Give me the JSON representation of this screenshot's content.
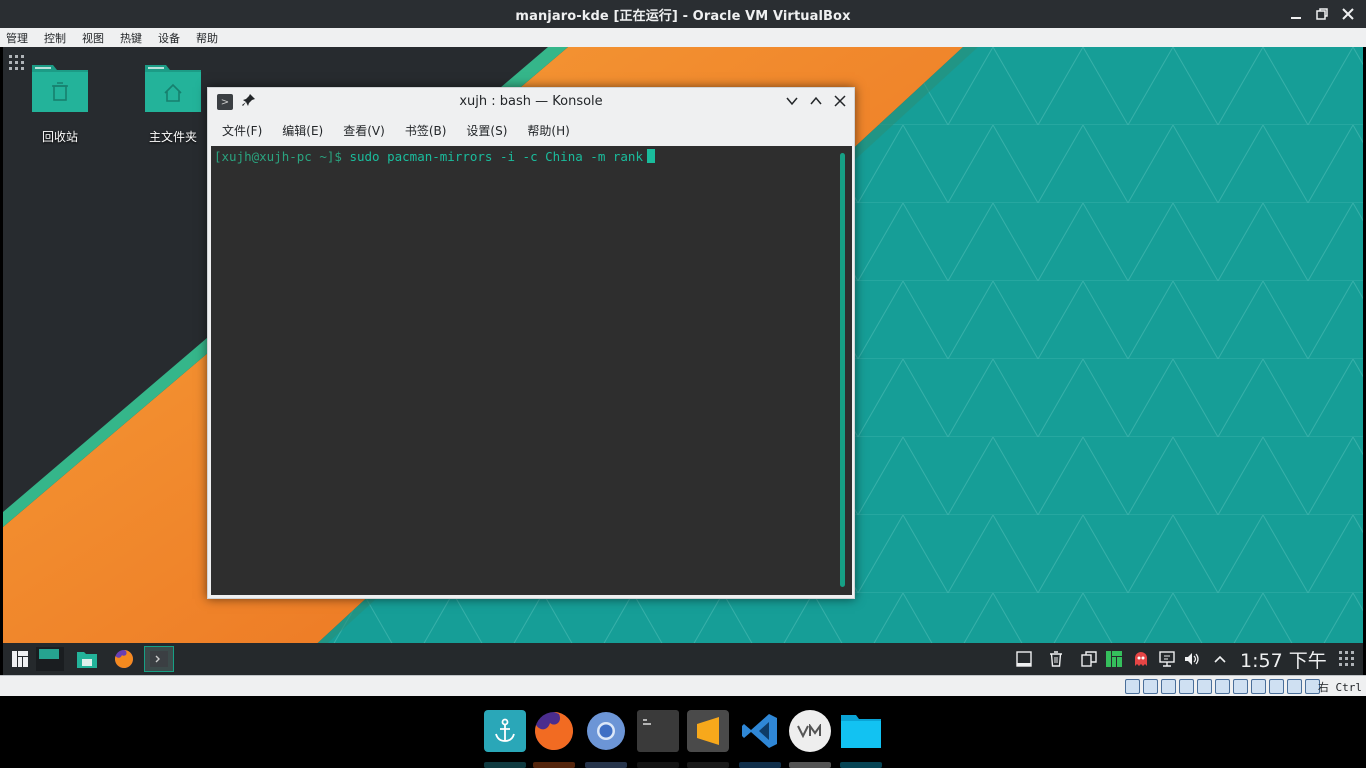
{
  "host": {
    "window_title": "manjaro-kde [正在运行] - Oracle VM VirtualBox",
    "menu": [
      "管理",
      "控制",
      "视图",
      "热键",
      "设备",
      "帮助"
    ],
    "host_key": "右 Ctrl"
  },
  "desktop": {
    "icons": [
      {
        "label": "回收站",
        "icon": "trash-folder-icon"
      },
      {
        "label": "主文件夹",
        "icon": "home-folder-icon"
      }
    ]
  },
  "konsole": {
    "title": "xujh : bash — Konsole",
    "menu": [
      "文件(F)",
      "编辑(E)",
      "查看(V)",
      "书签(B)",
      "设置(S)",
      "帮助(H)"
    ],
    "prompt": "[xujh@xujh-pc ~]$",
    "command": "sudo pacman-mirrors -i -c China -m rank"
  },
  "panel": {
    "clock": "1:57 下午"
  },
  "colors": {
    "accent": "#16a085",
    "terminal_text": "#1abc9c",
    "terminal_bg": "#2e2e2e",
    "panel_bg": "#25292c"
  }
}
